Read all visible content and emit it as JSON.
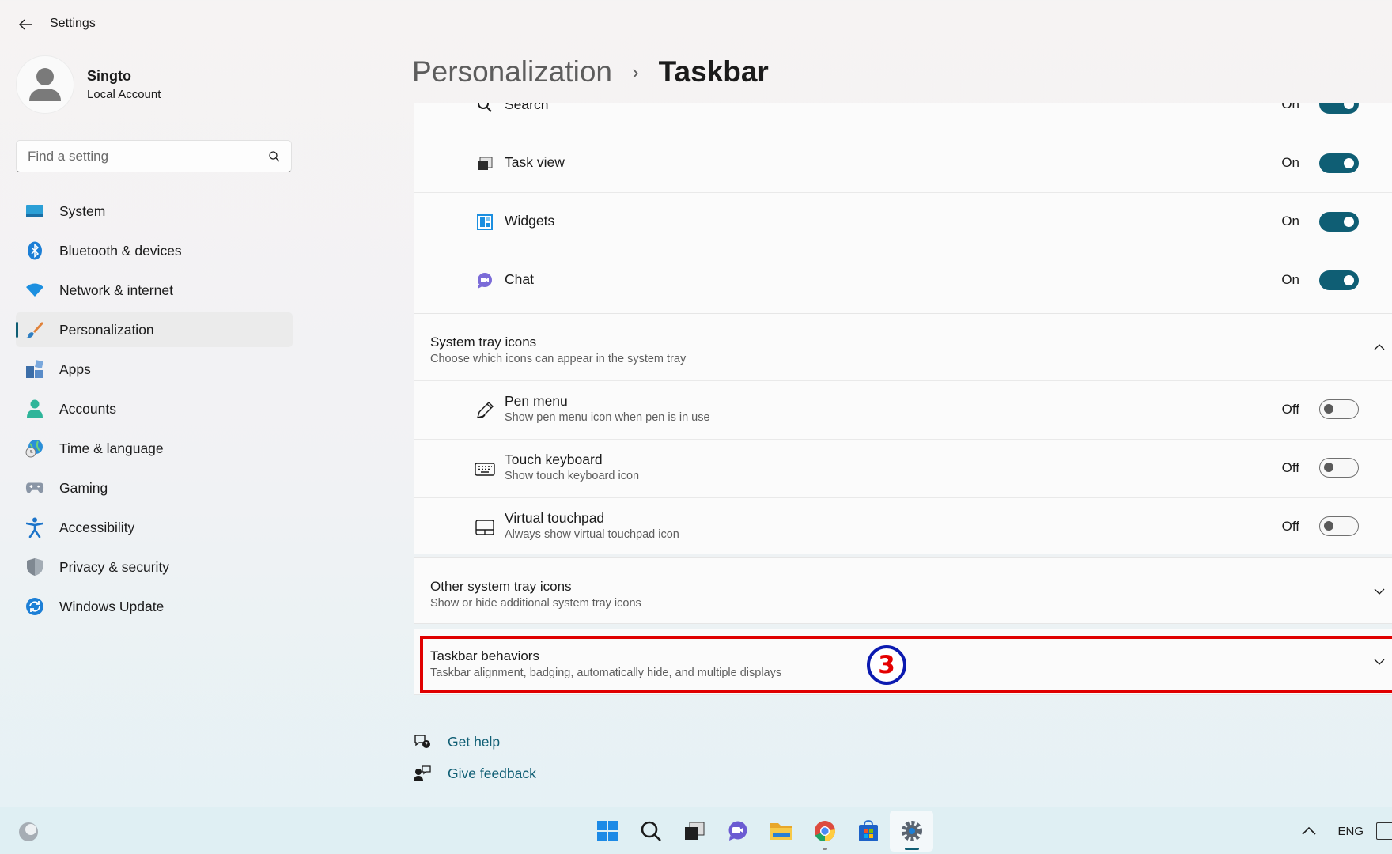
{
  "window": {
    "title": "Settings"
  },
  "profile": {
    "name": "Singto",
    "account_type": "Local Account"
  },
  "search": {
    "placeholder": "Find a setting"
  },
  "sidebar": {
    "items": [
      {
        "label": "System",
        "icon": "system-icon"
      },
      {
        "label": "Bluetooth & devices",
        "icon": "bluetooth-icon"
      },
      {
        "label": "Network & internet",
        "icon": "wifi-icon"
      },
      {
        "label": "Personalization",
        "icon": "brush-icon",
        "active": true
      },
      {
        "label": "Apps",
        "icon": "apps-icon"
      },
      {
        "label": "Accounts",
        "icon": "person-icon"
      },
      {
        "label": "Time & language",
        "icon": "globe-clock-icon"
      },
      {
        "label": "Gaming",
        "icon": "gamepad-icon"
      },
      {
        "label": "Accessibility",
        "icon": "accessibility-icon"
      },
      {
        "label": "Privacy & security",
        "icon": "shield-icon"
      },
      {
        "label": "Windows Update",
        "icon": "update-icon"
      }
    ]
  },
  "breadcrumb": {
    "parent": "Personalization",
    "separator": "›",
    "current": "Taskbar"
  },
  "taskbar_items": {
    "rows": [
      {
        "label": "Search",
        "state": "On",
        "enabled": true,
        "icon": "search-icon"
      },
      {
        "label": "Task view",
        "state": "On",
        "enabled": true,
        "icon": "task-view-icon"
      },
      {
        "label": "Widgets",
        "state": "On",
        "enabled": true,
        "icon": "widgets-icon"
      },
      {
        "label": "Chat",
        "state": "On",
        "enabled": true,
        "icon": "chat-icon"
      }
    ]
  },
  "system_tray": {
    "title": "System tray icons",
    "description": "Choose which icons can appear in the system tray",
    "expanded": true,
    "rows": [
      {
        "label": "Pen menu",
        "description": "Show pen menu icon when pen is in use",
        "state": "Off",
        "enabled": false,
        "icon": "pen-icon"
      },
      {
        "label": "Touch keyboard",
        "description": "Show touch keyboard icon",
        "state": "Off",
        "enabled": false,
        "icon": "keyboard-icon"
      },
      {
        "label": "Virtual touchpad",
        "description": "Always show virtual touchpad icon",
        "state": "Off",
        "enabled": false,
        "icon": "touchpad-icon"
      }
    ]
  },
  "other_tray": {
    "title": "Other system tray icons",
    "description": "Show or hide additional system tray icons",
    "expanded": false
  },
  "behaviors": {
    "title": "Taskbar behaviors",
    "description": "Taskbar alignment, badging, automatically hide, and multiple displays",
    "expanded": false
  },
  "annotation": {
    "marker": "3",
    "color": "#e00000",
    "ring_color": "#0b1ab0"
  },
  "links": {
    "help": "Get help",
    "feedback": "Give feedback"
  },
  "os_taskbar": {
    "pinned": [
      "start-icon",
      "search-icon",
      "task-view-icon",
      "chat-icon",
      "file-explorer-icon",
      "chrome-icon",
      "store-icon",
      "settings-icon"
    ],
    "language": "ENG"
  },
  "colors": {
    "accent": "#0f5e74",
    "highlight": "#e00000"
  }
}
